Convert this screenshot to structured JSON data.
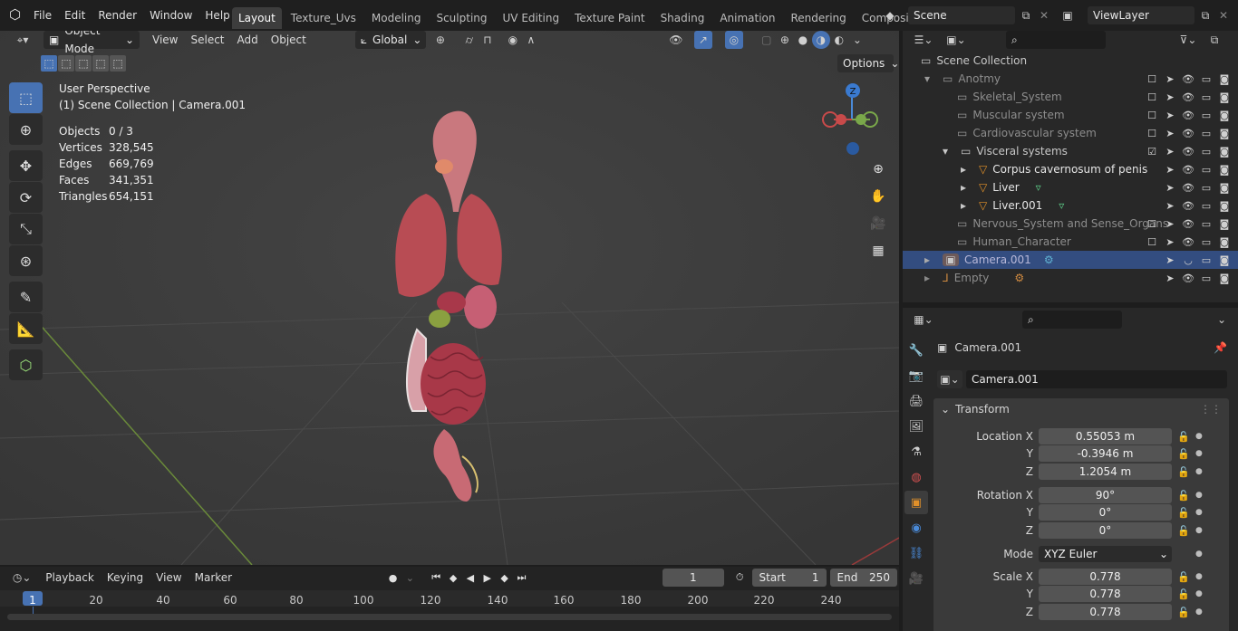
{
  "menu": [
    "File",
    "Edit",
    "Render",
    "Window",
    "Help"
  ],
  "workspaces": [
    "Layout",
    "Texture_Uvs",
    "Modeling",
    "Sculpting",
    "UV Editing",
    "Texture Paint",
    "Shading",
    "Animation",
    "Rendering",
    "Compositing"
  ],
  "scene_field": "Scene",
  "viewlayer_field": "ViewLayer",
  "viewport": {
    "mode": "Object Mode",
    "header_menus": [
      "View",
      "Select",
      "Add",
      "Object"
    ],
    "orientation": "Global",
    "options": "Options",
    "info_line1": "User Perspective",
    "info_line2": "(1) Scene Collection | Camera.001",
    "stats": [
      {
        "k": "Objects",
        "v": "0 / 3"
      },
      {
        "k": "Vertices",
        "v": "328,545"
      },
      {
        "k": "Edges",
        "v": "669,769"
      },
      {
        "k": "Faces",
        "v": "341,351"
      },
      {
        "k": "Triangles",
        "v": "654,151"
      }
    ],
    "gizmo_z": "Z"
  },
  "outliner": {
    "root": "Scene Collection",
    "rows": [
      {
        "label": "Anotmy",
        "dim": true,
        "arrow": "▾"
      },
      {
        "label": "Skeletal_System",
        "dim": true,
        "arrow": ""
      },
      {
        "label": "Muscular system",
        "dim": true,
        "arrow": ""
      },
      {
        "label": "Cardiovascular system",
        "dim": true,
        "arrow": ""
      },
      {
        "label": "Visceral systems",
        "dim": false,
        "arrow": "▾"
      },
      {
        "label": "Corpus cavernosum of penis",
        "dim": false,
        "arrow": "▸"
      },
      {
        "label": "Liver",
        "dim": false,
        "arrow": "▸"
      },
      {
        "label": "Liver.001",
        "dim": false,
        "arrow": "▸"
      },
      {
        "label": "Nervous_System and Sense_Organs",
        "dim": true,
        "arrow": ""
      },
      {
        "label": "Human_Character",
        "dim": true,
        "arrow": ""
      },
      {
        "label": "Camera.001",
        "dim": false,
        "arrow": "▸",
        "sel": true
      },
      {
        "label": "Empty",
        "dim": true,
        "arrow": "▸"
      }
    ]
  },
  "properties": {
    "object_name": "Camera.001",
    "name_field": "Camera.001",
    "section": "Transform",
    "rows": [
      {
        "label": "Location X",
        "value": "0.55053 m"
      },
      {
        "label": "Y",
        "value": "-0.3946 m"
      },
      {
        "label": "Z",
        "value": "1.2054 m"
      },
      {
        "label": "Rotation X",
        "value": "90°"
      },
      {
        "label": "Y",
        "value": "0°"
      },
      {
        "label": "Z",
        "value": "0°"
      },
      {
        "label": "Mode",
        "value": "XYZ Euler"
      },
      {
        "label": "Scale X",
        "value": "0.778"
      },
      {
        "label": "Y",
        "value": "0.778"
      },
      {
        "label": "Z",
        "value": "0.778"
      }
    ]
  },
  "timeline": {
    "menus": [
      "Playback",
      "Keying",
      "View",
      "Marker"
    ],
    "current_frame": "1",
    "start_label": "Start",
    "start_value": "1",
    "end_label": "End",
    "end_value": "250",
    "ruler": [
      "1",
      "20",
      "40",
      "60",
      "80",
      "100",
      "120",
      "140",
      "160",
      "180",
      "200",
      "220",
      "240"
    ]
  }
}
